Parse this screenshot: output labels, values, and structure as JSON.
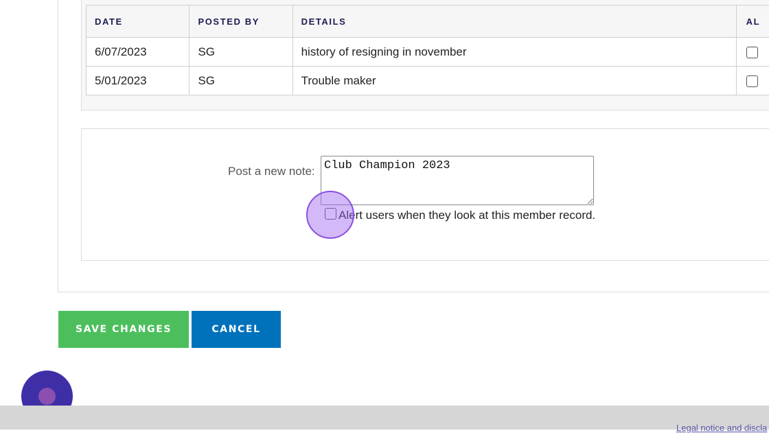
{
  "notes_table": {
    "headers": {
      "date": "DATE",
      "posted_by": "POSTED BY",
      "details": "DETAILS",
      "alert": "AL"
    },
    "rows": [
      {
        "date": "6/07/2023",
        "posted_by": "SG",
        "details": "history of resigning in november",
        "alert": false
      },
      {
        "date": "5/01/2023",
        "posted_by": "SG",
        "details": "Trouble maker",
        "alert": false
      }
    ]
  },
  "new_note": {
    "label": "Post a new note:",
    "value": "Club Champion 2023",
    "alert_label": "Alert users when they look at this member record.",
    "alert_checked": false
  },
  "actions": {
    "save_label": "SAVE CHANGES",
    "cancel_label": "CANCEL"
  },
  "footer": {
    "legal_link": "Legal notice and discla"
  },
  "colors": {
    "save_button": "#4cbf5c",
    "cancel_button": "#0072bb",
    "header_text": "#1c1c55",
    "chat_launcher": "#3f2fa6",
    "click_indicator": "#a064f0"
  },
  "icons": {
    "chat_launcher": "chat-bubble-icon",
    "textarea_resize": "resize-grip-icon"
  }
}
